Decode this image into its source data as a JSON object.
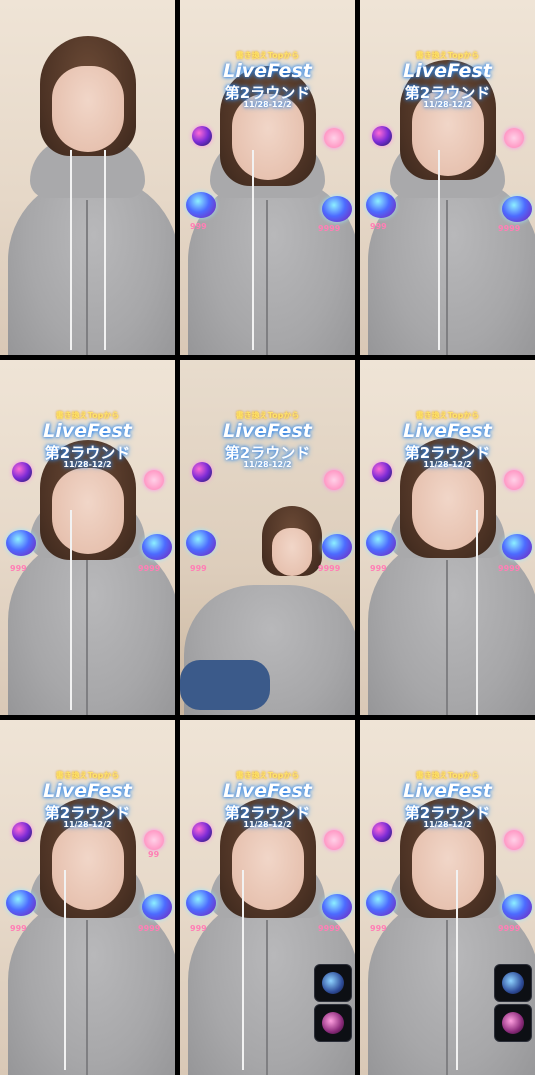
{
  "overlay": {
    "tag": "書き換えTopから",
    "main": "LiveFest",
    "round": "第2ラウンド",
    "dates": "11/28-12/2",
    "left_score": "999",
    "right_score": "9999",
    "side_marker": "99"
  },
  "tiles": [
    {
      "id": 1,
      "overlay": false
    },
    {
      "id": 2,
      "overlay": true
    },
    {
      "id": 3,
      "overlay": true
    },
    {
      "id": 4,
      "overlay": true
    },
    {
      "id": 5,
      "overlay": true
    },
    {
      "id": 6,
      "overlay": true
    },
    {
      "id": 7,
      "overlay": true
    },
    {
      "id": 8,
      "overlay": true,
      "mini_icons": true
    },
    {
      "id": 9,
      "overlay": true,
      "mini_icons": true
    }
  ]
}
